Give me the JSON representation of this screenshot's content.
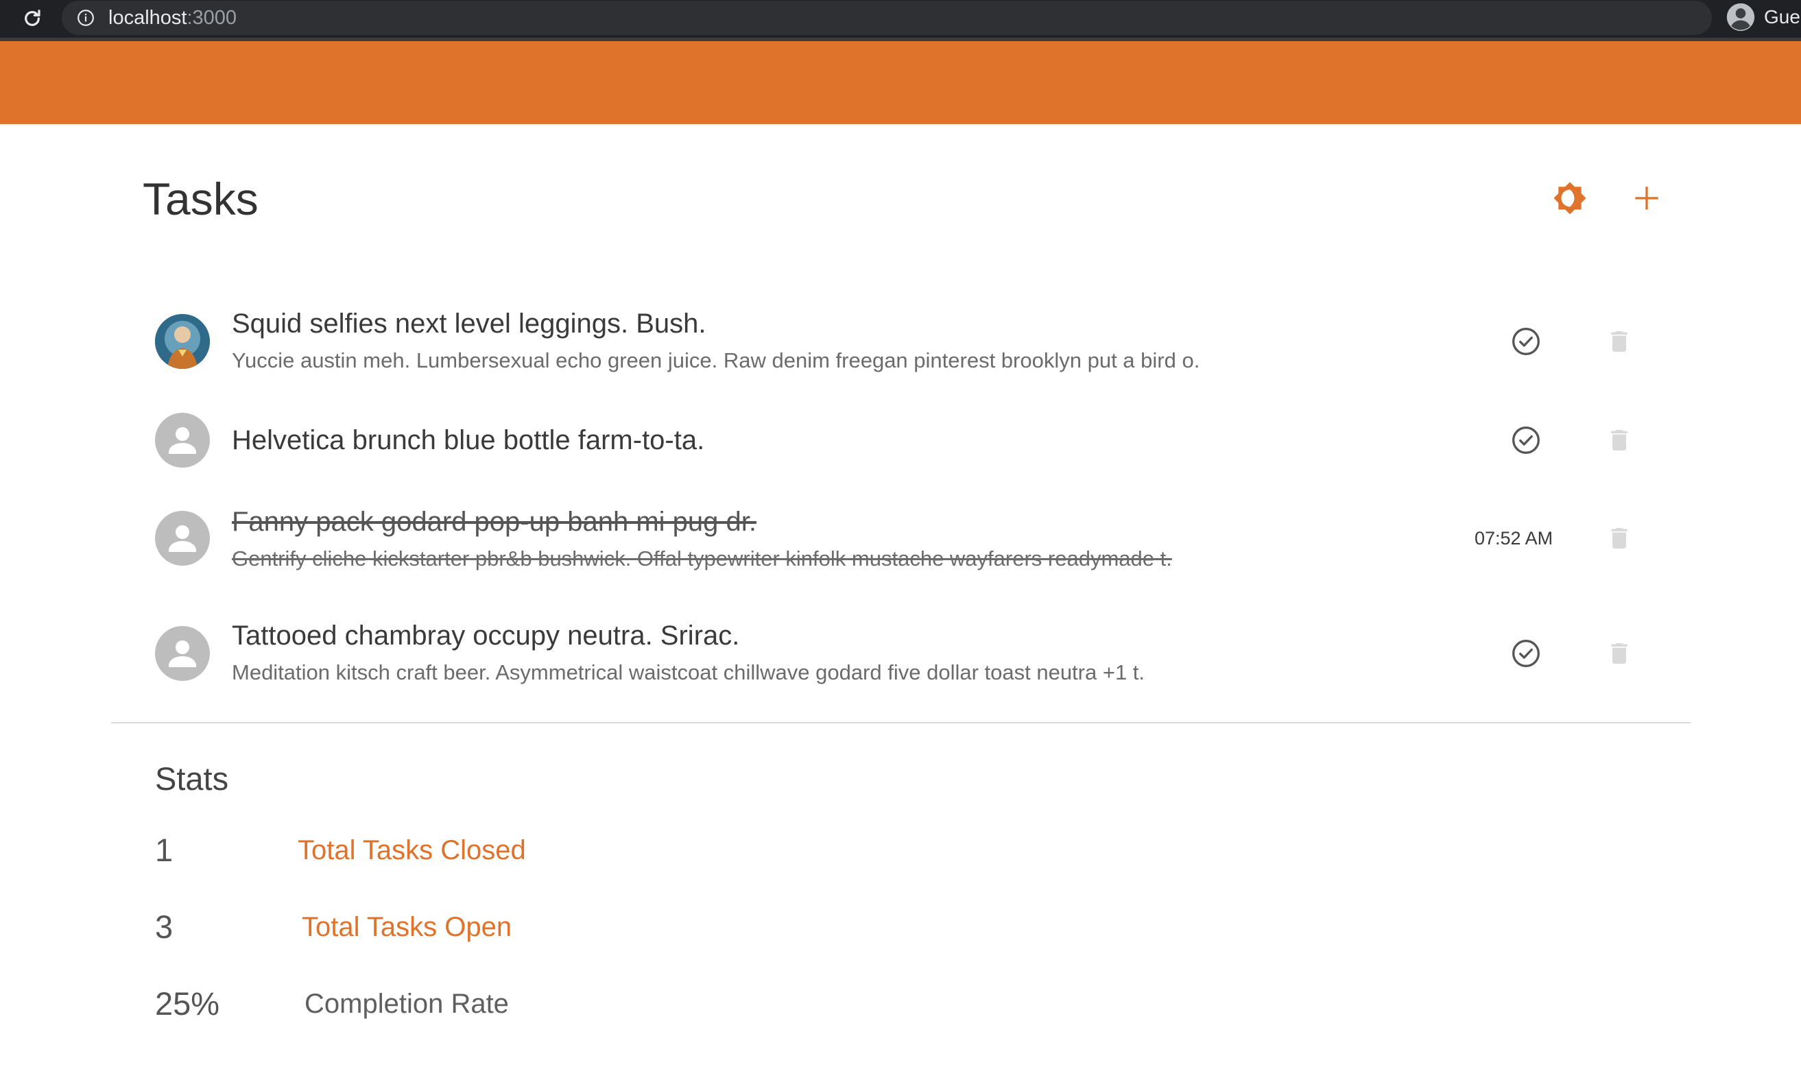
{
  "browser": {
    "url_host": "localhost",
    "url_port": ":3000",
    "profile_label": "Gue"
  },
  "colors": {
    "accent": "#e0732c",
    "browser_bar": "#202124",
    "text_primary": "#3a3a3a",
    "text_secondary": "#6b6b6b"
  },
  "header": {
    "title": "Tasks",
    "theme_toggle_icon": "brightness-icon",
    "add_icon": "plus-icon"
  },
  "tasks": [
    {
      "title": "Squid selfies next level leggings. Bush.",
      "description": "Yuccie austin meh. Lumbersexual echo green juice. Raw denim freegan pinterest brooklyn put a bird o.",
      "avatar": "user-photo",
      "completed": false
    },
    {
      "title": "Helvetica brunch blue bottle farm-to-ta.",
      "description": "",
      "avatar": "default-person-icon",
      "completed": false
    },
    {
      "title": "Fanny pack godard pop-up banh mi pug dr.",
      "description": "Gentrify cliche kickstarter pbr&b bushwick. Offal typewriter kinfolk mustache wayfarers readymade t.",
      "avatar": "default-person-icon",
      "completed": true,
      "completed_time": "07:52 AM"
    },
    {
      "title": "Tattooed chambray occupy neutra. Srirac.",
      "description": "Meditation kitsch craft beer. Asymmetrical waistcoat chillwave godard five dollar toast neutra +1 t.",
      "avatar": "default-person-icon",
      "completed": false
    }
  ],
  "stats": {
    "heading": "Stats",
    "closed": {
      "value": "1",
      "label": "Total Tasks Closed"
    },
    "open": {
      "value": "3",
      "label": "Total Tasks Open"
    },
    "rate": {
      "value": "25%",
      "label": "Completion Rate"
    }
  }
}
